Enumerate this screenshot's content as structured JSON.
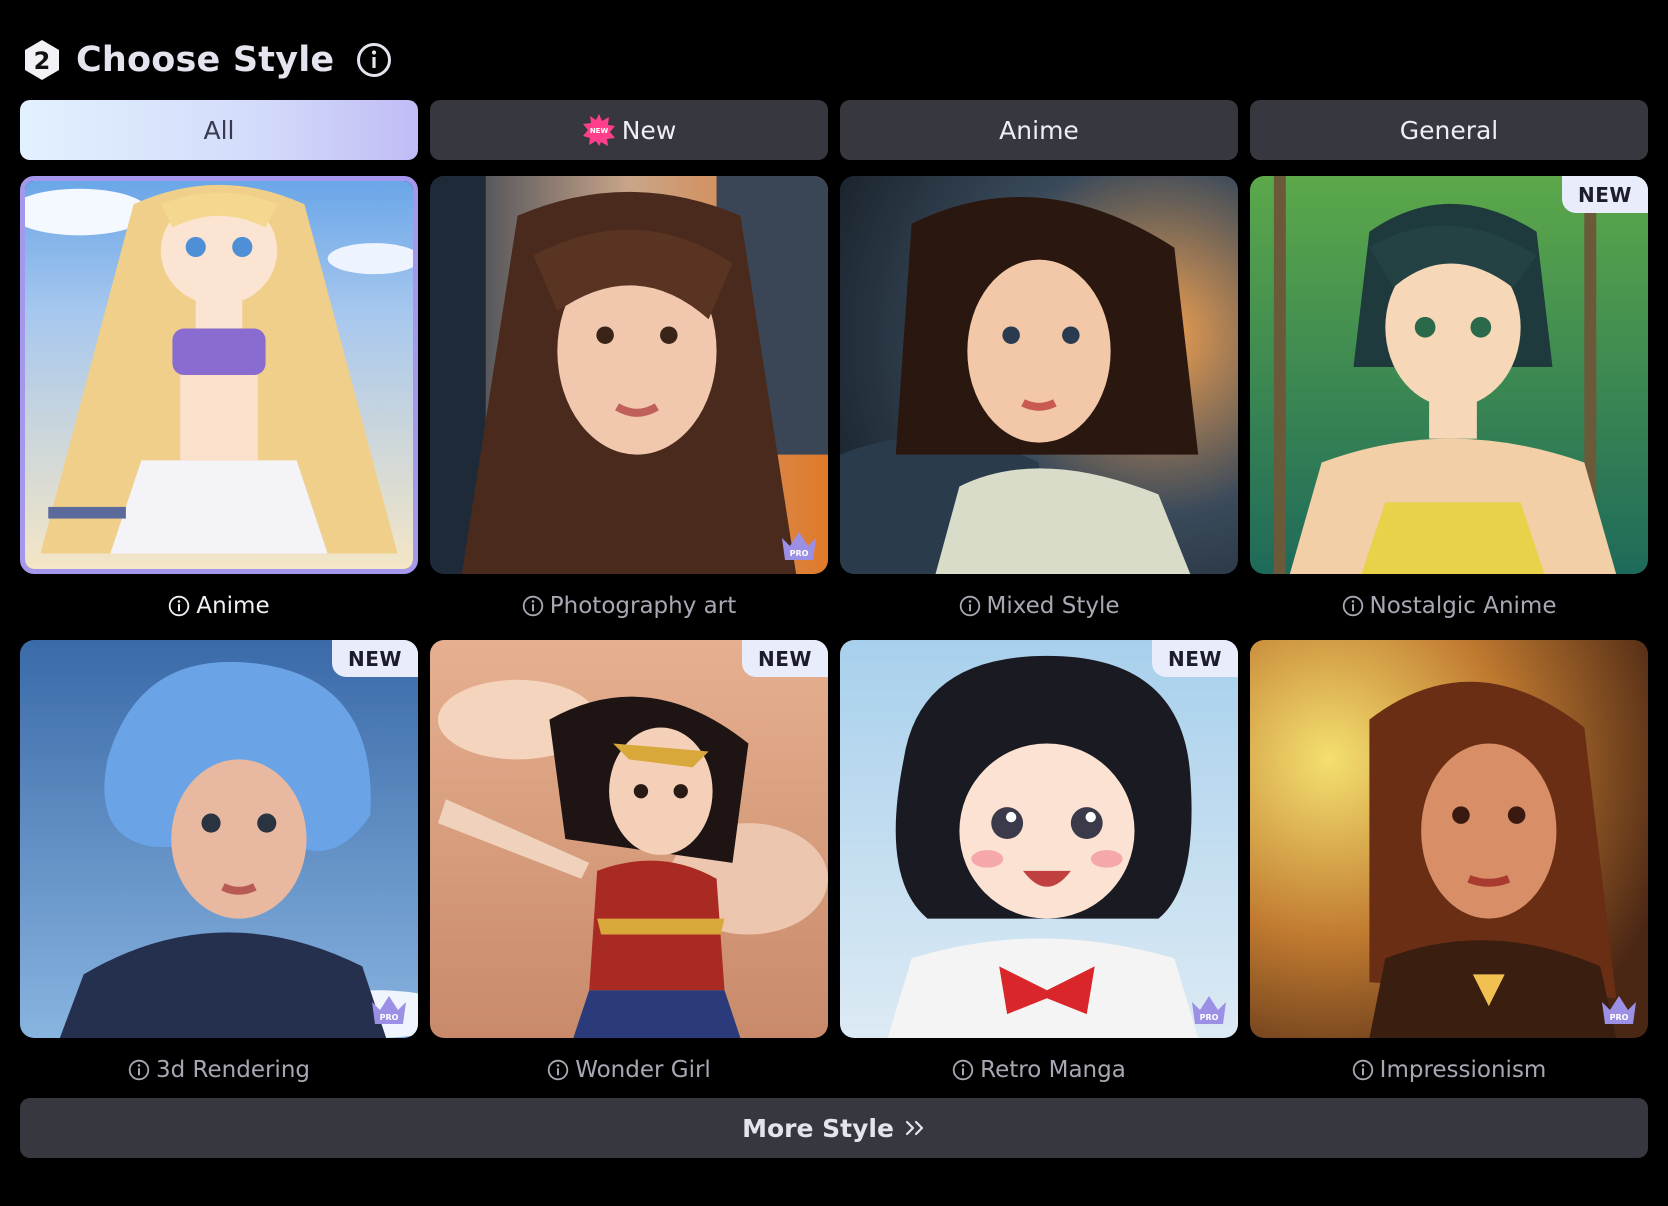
{
  "header": {
    "step_number": "2",
    "title": "Choose Style"
  },
  "tabs": [
    {
      "label": "All",
      "active": true
    },
    {
      "label": "New",
      "active": false,
      "icon": "new-burst-icon"
    },
    {
      "label": "Anime",
      "active": false
    },
    {
      "label": "General",
      "active": false
    }
  ],
  "styles": [
    {
      "label": "Anime",
      "selected": true,
      "badge_new": "",
      "pro": false
    },
    {
      "label": "Photography art",
      "selected": false,
      "badge_new": "",
      "pro": true
    },
    {
      "label": "Mixed Style",
      "selected": false,
      "badge_new": "",
      "pro": false
    },
    {
      "label": "Nostalgic Anime",
      "selected": false,
      "badge_new": "NEW",
      "pro": false
    },
    {
      "label": "3d Rendering",
      "selected": false,
      "badge_new": "NEW",
      "pro": true
    },
    {
      "label": "Wonder Girl",
      "selected": false,
      "badge_new": "NEW",
      "pro": false
    },
    {
      "label": "Retro Manga",
      "selected": false,
      "badge_new": "NEW",
      "pro": true
    },
    {
      "label": "Impressionism",
      "selected": false,
      "badge_new": "",
      "pro": true
    }
  ],
  "pro_badge_text": "PRO",
  "new_burst_text": "NEW",
  "more_button": {
    "label": "More Style"
  },
  "colors": {
    "background": "#000000",
    "tab_bg": "#37373f",
    "selected_border": "#a598ec",
    "new_badge_bg": "#e9ecfb"
  }
}
